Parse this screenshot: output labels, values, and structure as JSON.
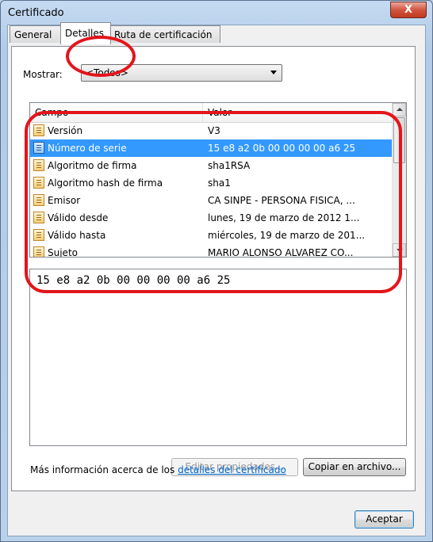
{
  "window": {
    "title": "Certificado",
    "close_glyph": "X"
  },
  "tabs": [
    {
      "label": "General",
      "active": false
    },
    {
      "label": "Detalles",
      "active": true
    },
    {
      "label": "Ruta de certificación",
      "active": false
    }
  ],
  "filter": {
    "label": "Mostrar:",
    "selected": "<Todos>"
  },
  "list": {
    "columns": [
      "Campo",
      "Valor"
    ],
    "rows": [
      {
        "field": "Versión",
        "value": "V3",
        "selected": false
      },
      {
        "field": "Número de serie",
        "value": "15 e8 a2 0b 00 00 00 00 a6 25",
        "selected": true
      },
      {
        "field": "Algoritmo de firma",
        "value": "sha1RSA",
        "selected": false
      },
      {
        "field": "Algoritmo hash de firma",
        "value": "sha1",
        "selected": false
      },
      {
        "field": "Emisor",
        "value": "CA SINPE - PERSONA FISICA, ...",
        "selected": false
      },
      {
        "field": "Válido desde",
        "value": "lunes, 19 de marzo de 2012 1...",
        "selected": false
      },
      {
        "field": "Válido hasta",
        "value": "miércoles, 19 de marzo de 201...",
        "selected": false
      },
      {
        "field": "Sujeto",
        "value": "MARIO ALONSO ALVAREZ CO...",
        "selected": false
      }
    ]
  },
  "detail": {
    "text": "15 e8 a2 0b 00 00 00 00 a6 25"
  },
  "buttons": {
    "edit": "Editar propiedades...",
    "copy": "Copiar en archivo...",
    "ok": "Aceptar"
  },
  "more_info": {
    "prefix": "Más información acerca de los ",
    "link": "detalles del certificado"
  },
  "colors": {
    "selection": "#3399ff",
    "annotation": "#e3151b",
    "link": "#0066cc"
  }
}
